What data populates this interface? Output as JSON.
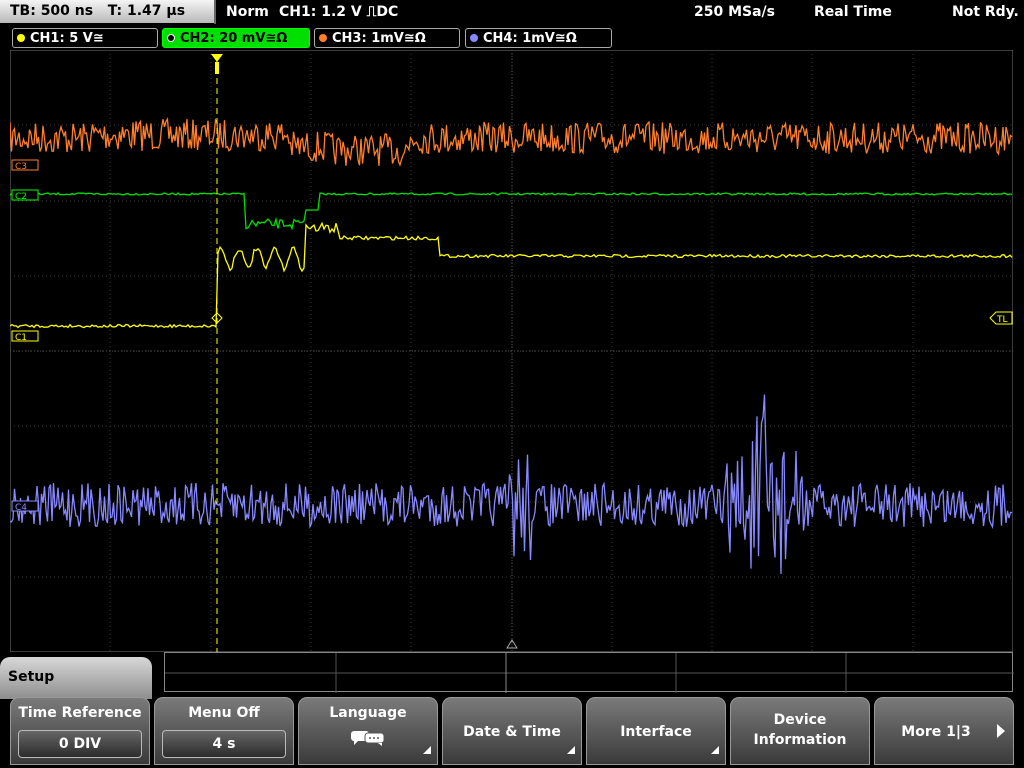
{
  "topbar": {
    "timebase": "TB: 500 ns",
    "trigger_time": "T: 1.47 µs",
    "mode": "Norm",
    "trigger_info": "CH1: 1.2 V ⎍DC",
    "sample_rate": "250 MSa/s",
    "acq_mode": "Real Time",
    "status": "Not Rdy."
  },
  "channels": [
    {
      "label": "CH1: 5 V≅",
      "color": "#ffff00"
    },
    {
      "label": "CH2: 20 mV≅Ω",
      "color": "#00ff00"
    },
    {
      "label": "CH3: 1mV≅Ω",
      "color": "#ff7f2a"
    },
    {
      "label": "CH4: 1mV≅Ω",
      "color": "#8888ff"
    }
  ],
  "markers": {
    "c3": "C3",
    "c2": "C2",
    "c1": "C1",
    "c4": "C4",
    "tl": "TL"
  },
  "setup_tab": "Setup",
  "softkeys": {
    "time_reference": {
      "label": "Time Reference",
      "value": "0 DIV"
    },
    "menu_off": {
      "label": "Menu Off",
      "value": "4 s"
    },
    "language": {
      "label": "Language",
      "icon": "speech-bubble-icon"
    },
    "date_time": {
      "label": "Date & Time"
    },
    "interface": {
      "label": "Interface"
    },
    "device_info": {
      "label1": "Device",
      "label2": "Information"
    },
    "more": {
      "label": "More 1|3"
    }
  }
}
